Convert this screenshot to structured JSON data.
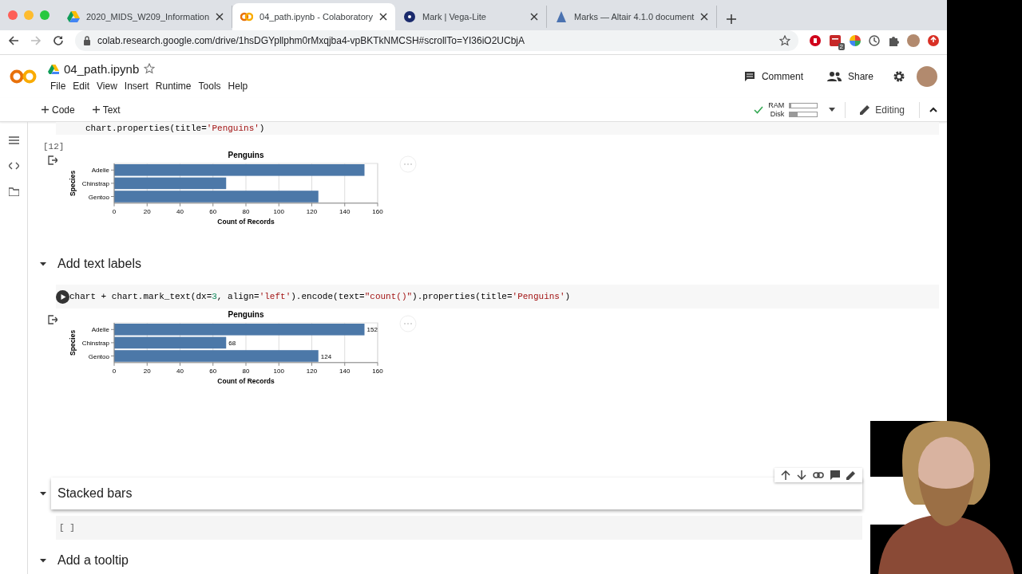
{
  "browser": {
    "tabs": [
      {
        "title": "2020_MIDS_W209_Information",
        "selected": false
      },
      {
        "title": "04_path.ipynb - Colaboratory",
        "selected": true
      },
      {
        "title": "Mark | Vega-Lite",
        "selected": false
      },
      {
        "title": "Marks — Altair 4.1.0 document",
        "selected": false
      }
    ],
    "url": "colab.research.google.com/drive/1hsDGYpllphm0rMxqjba4-vpBKTkNMCSH#scrollTo=YI36iO2UCbjA",
    "extension_badge": "2"
  },
  "notebook": {
    "title": "04_path.ipynb",
    "menu": [
      "File",
      "Edit",
      "View",
      "Insert",
      "Runtime",
      "Tools",
      "Help"
    ],
    "comment": "Comment",
    "share": "Share"
  },
  "toolbar": {
    "add": [
      "Code",
      "Text"
    ],
    "ram_label": "RAM",
    "ram": {
      "level": 0.04
    },
    "disk_label": "Disk",
    "disk": {
      "level": 0.3
    },
    "mode": "Editing"
  },
  "cells": [
    {
      "kind": "code",
      "code": [
        {
          "text": "chart.properties(title=",
          "kind": "plain"
        },
        {
          "text": "'Penguins'",
          "kind": "string"
        },
        {
          "text": ")",
          "kind": "plain"
        }
      ],
      "count": "[12]",
      "output": {
        "chart_data": {
          "type": "bar",
          "orientation": "horizontal",
          "title": "Penguins",
          "xlabel": "Count of Records",
          "ylabel": "Species",
          "categories": [
            "Adelie",
            "Chinstrap",
            "Gentoo"
          ],
          "values": [
            152,
            68,
            124
          ],
          "xlim": [
            0,
            160
          ],
          "xticks": [
            0,
            20,
            40,
            60,
            80,
            100,
            120,
            140,
            160
          ],
          "grid": true
        }
      }
    },
    {
      "kind": "heading",
      "text": "Add text labels",
      "expanded": true,
      "selected": false
    },
    {
      "kind": "code",
      "code": [
        {
          "text": "chart + chart.mark_text(dx=",
          "kind": "plain"
        },
        {
          "text": "3",
          "kind": "number"
        },
        {
          "text": ", align=",
          "kind": "plain"
        },
        {
          "text": "'left'",
          "kind": "string"
        },
        {
          "text": ").encode(text=",
          "kind": "plain"
        },
        {
          "text": "\"count()\"",
          "kind": "string"
        },
        {
          "text": ").properties(title=",
          "kind": "plain"
        },
        {
          "text": "'Penguins'",
          "kind": "string"
        },
        {
          "text": ")",
          "kind": "plain"
        }
      ],
      "output": {
        "chart_data": {
          "type": "bar",
          "orientation": "horizontal",
          "title": "Penguins",
          "xlabel": "Count of Records",
          "ylabel": "Species",
          "categories": [
            "Adelie",
            "Chinstrap",
            "Gentoo"
          ],
          "values": [
            152,
            68,
            124
          ],
          "xlim": [
            0,
            160
          ],
          "xticks": [
            0,
            20,
            40,
            60,
            80,
            100,
            120,
            140,
            160
          ],
          "grid": true,
          "data_labels": true
        }
      }
    },
    {
      "kind": "heading",
      "text": "Stacked bars",
      "expanded": true,
      "selected": true
    },
    {
      "kind": "code",
      "count": "[ ]"
    },
    {
      "kind": "heading",
      "text": "Add a tooltip",
      "expanded": true,
      "selected": false
    }
  ]
}
